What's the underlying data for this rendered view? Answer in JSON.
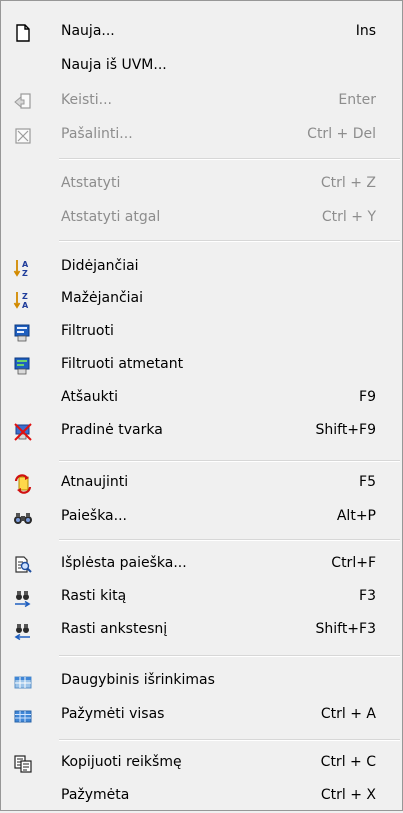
{
  "menu": {
    "new": {
      "label": "Nauja...",
      "shortcut": "Ins"
    },
    "new_from_uvm": {
      "label": "Nauja iš UVM..."
    },
    "edit": {
      "label": "Keisti...",
      "shortcut": "Enter"
    },
    "delete": {
      "label": "Pašalinti...",
      "shortcut": "Ctrl + Del"
    },
    "undo": {
      "label": "Atstatyti",
      "shortcut": "Ctrl + Z"
    },
    "redo": {
      "label": "Atstatyti atgal",
      "shortcut": "Ctrl + Y"
    },
    "sort_asc": {
      "label": "Didėjančiai"
    },
    "sort_desc": {
      "label": "Mažėjančiai"
    },
    "filter": {
      "label": "Filtruoti"
    },
    "filter_exclude": {
      "label": "Filtruoti atmetant"
    },
    "cancel": {
      "label": "Atšaukti",
      "shortcut": "F9"
    },
    "initial_order": {
      "label": "Pradinė tvarka",
      "shortcut": "Shift+F9"
    },
    "refresh": {
      "label": "Atnaujinti",
      "shortcut": "F5"
    },
    "search": {
      "label": "Paieška...",
      "shortcut": "Alt+P"
    },
    "advanced_search": {
      "label": "Išplėsta paieška...",
      "shortcut": "Ctrl+F"
    },
    "find_next": {
      "label": "Rasti kitą",
      "shortcut": "F3"
    },
    "find_previous": {
      "label": "Rasti ankstesnį",
      "shortcut": "Shift+F3"
    },
    "multi_select": {
      "label": "Daugybinis išrinkimas"
    },
    "select_all": {
      "label": "Pažymėti visas",
      "shortcut": "Ctrl + A"
    },
    "copy_value": {
      "label": "Kopijuoti reikšmę",
      "shortcut": "Ctrl + C"
    },
    "marked": {
      "label": "Pažymėta",
      "shortcut": "Ctrl + X"
    }
  },
  "colors": {
    "menu_background": "#f0f0f0",
    "disabled_text": "#8d8d8d",
    "separator": "#d7d7d7"
  }
}
